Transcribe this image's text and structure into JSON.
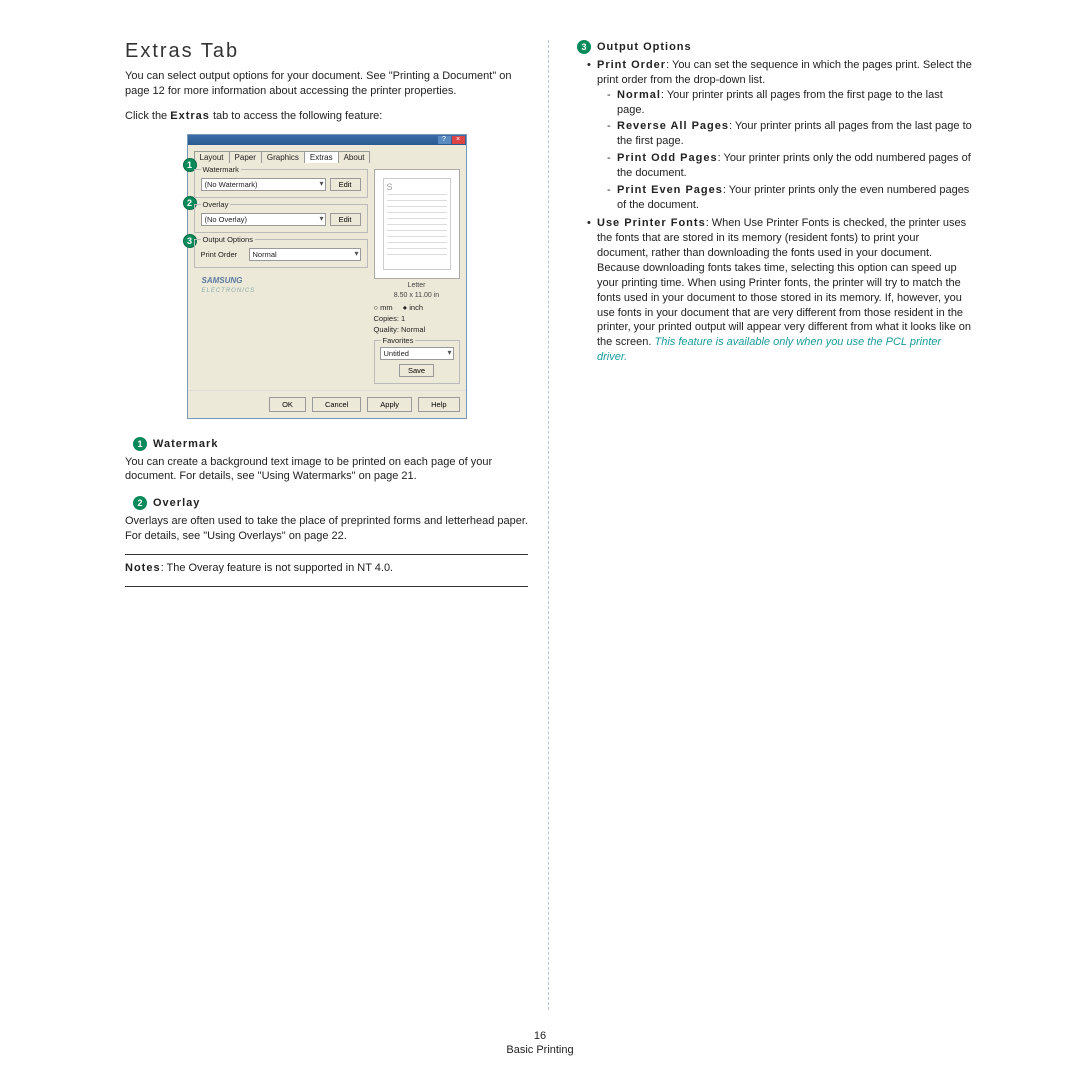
{
  "left": {
    "heading": "Extras Tab",
    "intro1": "You can select output options for your document. See \"Printing a Document\" on page 12 for more information about accessing the printer properties.",
    "intro2_pre": "Click the ",
    "intro2_bold": "Extras",
    "intro2_post": " tab to access the following feature:",
    "watermark": {
      "num": "1",
      "title": "Watermark",
      "body": "You can create a background text image to be printed on each page of your document. For details, see \"Using Watermarks\" on page 21."
    },
    "overlay": {
      "num": "2",
      "title": "Overlay",
      "body": "Overlays are often used to take the place of preprinted forms and letterhead paper. For details, see \"Using Overlays\" on page 22."
    },
    "notes_label": "Notes",
    "notes_body": ": The Overay feature is not supported in NT 4.0."
  },
  "dialog": {
    "tabs": [
      "Layout",
      "Paper",
      "Graphics",
      "Extras",
      "About"
    ],
    "watermark_label": "Watermark",
    "watermark_value": "(No Watermark)",
    "overlay_label": "Overlay",
    "overlay_value": "(No Overlay)",
    "output_label": "Output Options",
    "printorder_label": "Print Order",
    "printorder_value": "Normal",
    "edit": "Edit",
    "preview_s": "S",
    "preview_paper": "Letter",
    "preview_dim": "8.50 x 11.00 in",
    "unit_mm": "mm",
    "unit_inch": "inch",
    "copies": "Copies: 1",
    "quality": "Quality: Normal",
    "favorites": "Favorites",
    "fav_value": "Untitled",
    "save": "Save",
    "logo_brand": "SAMSUNG",
    "logo_sub": "ELECTRONICS",
    "ok": "OK",
    "cancel": "Cancel",
    "apply": "Apply",
    "help": "Help"
  },
  "right": {
    "num": "3",
    "title": "Output Options",
    "po_label": "Print Order",
    "po_desc": ": You can set the sequence in which the pages print. Select the print order from the drop-down list.",
    "normal_label": "Normal",
    "normal_desc": ": Your printer prints all pages from the first page to the last page.",
    "rev_label": "Reverse All Pages",
    "rev_desc": ": Your printer prints all pages from the last page to the first page.",
    "odd_label": "Print Odd Pages",
    "odd_desc": ": Your printer prints only the odd numbered pages of the document.",
    "even_label": "Print Even Pages",
    "even_desc": ": Your printer prints only the even numbered pages of the document.",
    "upf_label": "Use Printer Fonts",
    "upf_desc": ": When Use Printer Fonts is checked, the printer uses the fonts that are stored in its memory (resident fonts) to print your document, rather than downloading the fonts used in your document. Because downloading fonts takes time, selecting this option can speed up your printing time. When using Printer fonts, the printer will try to match the fonts used in your document to those stored in its memory. If, however, you use fonts in your document that are very different from those resident in the printer, your printed output will appear very different from what it looks like on the screen.",
    "teal": "This feature is available only when you use the PCL printer driver."
  },
  "footer": {
    "page": "16",
    "title": "Basic Printing"
  }
}
